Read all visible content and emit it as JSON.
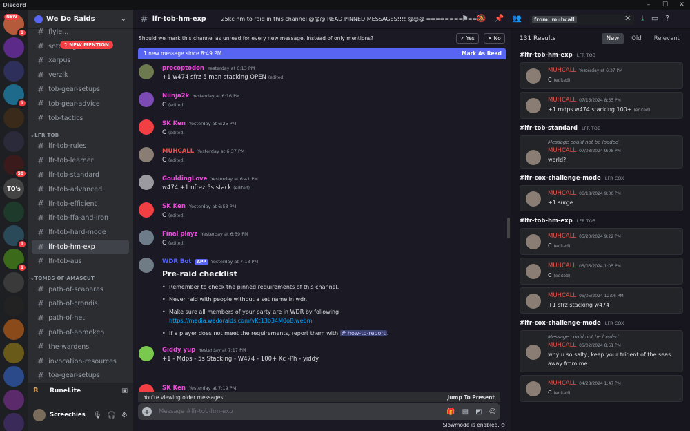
{
  "app_title": "Discord",
  "guild_new": "NEW",
  "guild_badges": [
    "1",
    "1",
    "58",
    "1",
    "1"
  ],
  "guild_text": "TO's",
  "mention_pill": "1 NEW MENTION",
  "server": {
    "name": "We Do Raids"
  },
  "channels": [
    {
      "type": "ch",
      "name": "flyle..."
    },
    {
      "type": "ch",
      "name": "sotetseg"
    },
    {
      "type": "ch",
      "name": "xarpus"
    },
    {
      "type": "ch",
      "name": "verzik"
    },
    {
      "type": "ch",
      "name": "tob-gear-setups"
    },
    {
      "type": "ch",
      "name": "tob-gear-advice"
    },
    {
      "type": "ch",
      "name": "tob-tactics"
    },
    {
      "type": "cat",
      "name": "LFR TOB"
    },
    {
      "type": "ch",
      "name": "lfr-tob-rules"
    },
    {
      "type": "ch",
      "name": "lfr-tob-learner"
    },
    {
      "type": "ch",
      "name": "lfr-tob-standard"
    },
    {
      "type": "ch",
      "name": "lfr-tob-advanced"
    },
    {
      "type": "ch",
      "name": "lfr-tob-efficient"
    },
    {
      "type": "ch",
      "name": "lfr-tob-ffa-and-iron"
    },
    {
      "type": "ch",
      "name": "lfr-tob-hard-mode"
    },
    {
      "type": "ch",
      "name": "lfr-tob-hm-exp",
      "selected": true
    },
    {
      "type": "ch",
      "name": "lfr-tob-aus"
    },
    {
      "type": "cat",
      "name": "TOMBS OF AMASCUT"
    },
    {
      "type": "ch",
      "name": "path-of-scabaras"
    },
    {
      "type": "ch",
      "name": "path-of-crondis"
    },
    {
      "type": "ch",
      "name": "path-of-het"
    },
    {
      "type": "ch",
      "name": "path-of-apmeken"
    },
    {
      "type": "ch",
      "name": "the-wardens"
    },
    {
      "type": "ch",
      "name": "invocation-resources"
    },
    {
      "type": "ch",
      "name": "toa-gear-setups"
    }
  ],
  "runelite": "RuneLite",
  "user": {
    "name": "Screechies"
  },
  "header": {
    "channel": "lfr-tob-hm-exp",
    "topic": "25kc hm to raid in this channel @@@ READ PINNED MESSAGES!!!! @@@ ============>"
  },
  "search": {
    "filter": "from: muhcall"
  },
  "unread_prompt": {
    "text": "Should we mark this channel as unread for every new message, instead of only mentions?",
    "yes": "Yes",
    "no": "No"
  },
  "new_bar": {
    "text": "1 new message since 8:49 PM",
    "action": "Mark As Read"
  },
  "messages": [
    {
      "author": "procoptodon",
      "color": "#e84cd9",
      "time": "Yesterday at 6:13 PM",
      "body": "+1 w474 sfrz 5 man stacking OPEN",
      "edited": "(edited)",
      "av": "#6d7a4f"
    },
    {
      "author": "Niinja2k",
      "color": "#e84cd9",
      "time": "Yesterday at 6:16 PM",
      "body": "C",
      "edited": "(edited)",
      "av": "#7b4bb3"
    },
    {
      "author": "SK Ken",
      "color": "#e84cd9",
      "time": "Yesterday at 6:25 PM",
      "body": "C",
      "edited": "(edited)",
      "av": "#f23f43"
    },
    {
      "author": "MUHCALL",
      "color": "#e8514b",
      "time": "Yesterday at 6:37 PM",
      "body": "C",
      "edited": "(edited)",
      "av": "#8a7e74"
    },
    {
      "author": "GouldingLove",
      "color": "#e84cd9",
      "time": "Yesterday at 6:41 PM",
      "body": "w474 +1 nfrez 5s stack",
      "edited": "(edited)",
      "av": "#9a9aa0"
    },
    {
      "author": "SK Ken",
      "color": "#e84cd9",
      "time": "Yesterday at 6:53 PM",
      "body": "C",
      "edited": "(edited)",
      "av": "#f23f43"
    },
    {
      "author": "Final playz",
      "color": "#e84cd9",
      "time": "Yesterday at 6:59 PM",
      "body": "C",
      "edited": "(edited)",
      "av": "#6e7c8a"
    }
  ],
  "bot": {
    "author": "WDR Bot",
    "badge": "APP",
    "time": "Yesterday at 7:13 PM",
    "title": "Pre-raid checklist",
    "items": [
      "Remember to check the pinned requirements of this channel.",
      "Never raid with people without a set name in wdr.",
      "Make sure all members of your party are in WDR by following",
      "If a player does not meet the requirements, report them with"
    ],
    "link": "https://media.wedoraids.com/vKt13b34M0oB.webm.",
    "channel_mention": "# how-to-report",
    "end": "."
  },
  "messages2": [
    {
      "author": "Giddy yup",
      "color": "#e84cd9",
      "time": "Yesterday at 7:17 PM",
      "body": "+1 - Mdps - 5s Stacking - W474 - 100+ Kc -Ph - yiddy",
      "av": "#7ac94f"
    },
    {
      "author": "SK Ken",
      "color": "#e84cd9",
      "time": "Yesterday at 7:19 PM",
      "body": "",
      "av": "#f23f43"
    }
  ],
  "older": {
    "text": "You're viewing older messages",
    "jump": "Jump To Present"
  },
  "composer": {
    "placeholder": "Message #lfr-tob-hm-exp",
    "slowmode": "Slowmode is enabled."
  },
  "results": {
    "count": "131 Results",
    "tabs": [
      "New",
      "Old",
      "Relevant"
    ],
    "groups": [
      {
        "channel": "lfr-tob-hm-exp",
        "folder": "LFR TOB",
        "items": [
          {
            "author": "MUHCALL",
            "time": "Yesterday at 6:37 PM",
            "body": "C",
            "edited": "(edited)"
          },
          {
            "author": "MUHCALL",
            "time": "07/15/2024 8:55 PM",
            "body": "+1 mdps w474 stacking 100+",
            "edited": "(edited)"
          }
        ]
      },
      {
        "channel": "lfr-tob-standard",
        "folder": "LFR TOB",
        "items": [
          {
            "notload": "Message could not be loaded",
            "author": "MUHCALL",
            "time": "07/03/2024 9:08 PM",
            "body": "world?"
          }
        ]
      },
      {
        "channel": "lfr-cox-challenge-mode",
        "folder": "LFR COX",
        "items": [
          {
            "author": "MUHCALL",
            "time": "06/18/2024 9:00 PM",
            "body": "+1 surge"
          }
        ]
      },
      {
        "channel": "lfr-tob-hm-exp",
        "folder": "LFR TOB",
        "items": [
          {
            "author": "MUHCALL",
            "time": "05/20/2024 9:22 PM",
            "body": "C",
            "edited": "(edited)"
          },
          {
            "author": "MUHCALL",
            "time": "05/05/2024 1:05 PM",
            "body": "C",
            "edited": "(edited)"
          },
          {
            "author": "MUHCALL",
            "time": "05/05/2024 12:06 PM",
            "body": "+1 sfrz stacking w474"
          }
        ]
      },
      {
        "channel": "lfr-cox-challenge-mode",
        "folder": "LFR COX",
        "items": [
          {
            "notload": "Message could not be loaded",
            "author": "MUHCALL",
            "time": "05/02/2024 8:51 PM",
            "body": "why u so salty, keep your trident of the seas away from me"
          },
          {
            "author": "MUHCALL",
            "time": "04/28/2024 1:47 PM",
            "body": "C",
            "edited": "(edited)"
          }
        ]
      }
    ]
  }
}
